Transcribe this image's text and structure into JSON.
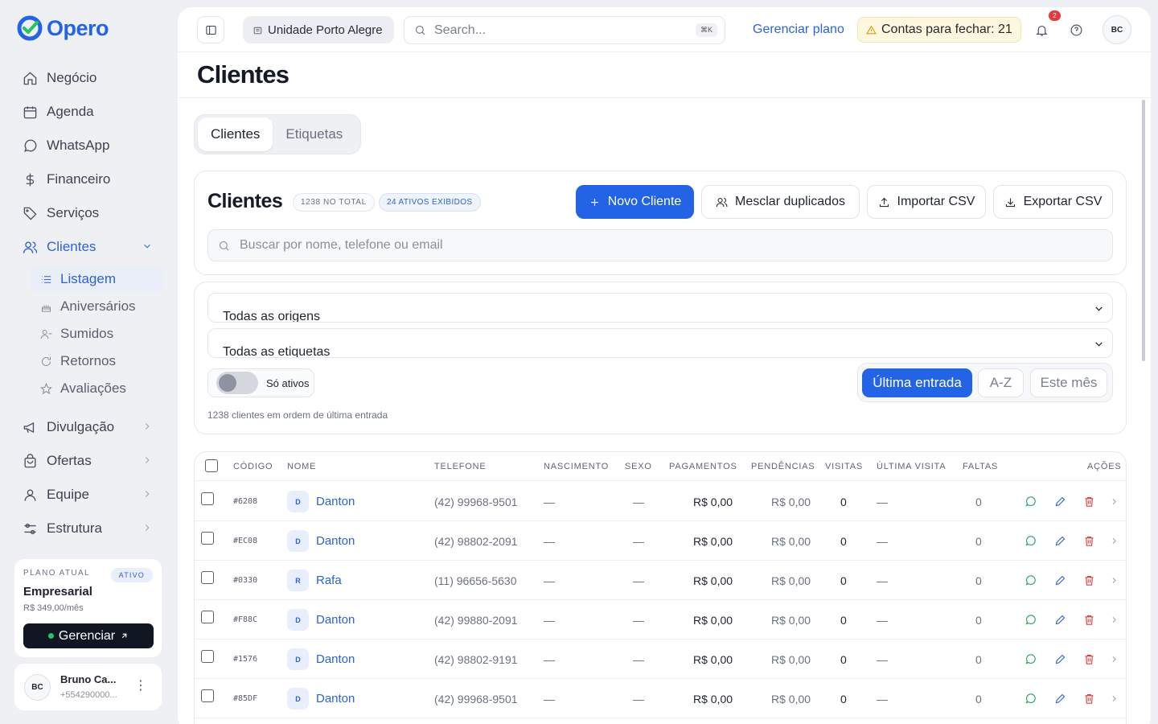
{
  "brand": {
    "name": "Opero",
    "color": "#2364e6"
  },
  "sidebar": {
    "items": [
      {
        "label": "Negócio",
        "icon": "home-icon"
      },
      {
        "label": "Agenda",
        "icon": "calendar-icon"
      },
      {
        "label": "WhatsApp",
        "icon": "message-icon"
      },
      {
        "label": "Financeiro",
        "icon": "dollar-icon"
      },
      {
        "label": "Serviços",
        "icon": "tag-icon"
      },
      {
        "label": "Clientes",
        "icon": "users-icon"
      }
    ],
    "clientes_sub": [
      {
        "label": "Listagem",
        "icon": "list-icon"
      },
      {
        "label": "Aniversários",
        "icon": "cake-icon"
      },
      {
        "label": "Sumidos",
        "icon": "user-minus-icon"
      },
      {
        "label": "Retornos",
        "icon": "refresh-icon"
      },
      {
        "label": "Avaliações",
        "icon": "star-icon"
      }
    ],
    "more_items": [
      {
        "label": "Divulgação",
        "icon": "megaphone-icon"
      },
      {
        "label": "Ofertas",
        "icon": "bag-icon"
      },
      {
        "label": "Equipe",
        "icon": "user-icon"
      },
      {
        "label": "Estrutura",
        "icon": "sliders-icon"
      }
    ],
    "plan": {
      "label": "PLANO ATUAL",
      "badge": "ATIVO",
      "name": "Empresarial",
      "price": "R$ 349,00/mês",
      "button": "Gerenciar"
    },
    "user": {
      "initials": "BC",
      "name": "Bruno Ca...",
      "phone": "+554290000..."
    }
  },
  "topbar": {
    "unit": "Unidade Porto Alegre",
    "search_placeholder": "Search...",
    "shortcut": "⌘K",
    "manage_plan": "Gerenciar plano",
    "accounts_warning": "Contas para fechar: 21",
    "notifications_count": "2",
    "avatar": "BC"
  },
  "page": {
    "title": "Clientes"
  },
  "tabs": [
    "Clientes",
    "Etiquetas"
  ],
  "clients_card": {
    "title": "Clientes",
    "badge_total": "1238 NO TOTAL",
    "badge_active": "24 ATIVOS EXIBIDOS",
    "new_client": "Novo Cliente",
    "merge": "Mesclar duplicados",
    "import": "Importar CSV",
    "export": "Exportar CSV",
    "search_placeholder": "Buscar por nome, telefone ou email"
  },
  "filters": {
    "origins": "Todas as origens",
    "tags": "Todas as etiquetas",
    "only_active": "Só ativos",
    "sort": [
      "Última entrada",
      "A-Z",
      "Este mês"
    ],
    "note": "1238 clientes em ordem de última entrada"
  },
  "table": {
    "headers": [
      "CÓDIGO",
      "NOME",
      "TELEFONE",
      "NASCIMENTO",
      "SEXO",
      "PAGAMENTOS",
      "PENDÊNCIAS",
      "VISITAS",
      "ÚLTIMA VISITA",
      "FALTAS",
      "AÇÕES"
    ],
    "rows": [
      {
        "code": "#6208",
        "initial": "D",
        "name": "Danton",
        "phone": "(42) 99968-9501",
        "birth": "—",
        "sex": "—",
        "payments": "R$ 0,00",
        "pending": "R$ 0,00",
        "visits": "0",
        "last_visit": "—",
        "absences": "0"
      },
      {
        "code": "#EC08",
        "initial": "D",
        "name": "Danton",
        "phone": "(42) 98802-2091",
        "birth": "—",
        "sex": "—",
        "payments": "R$ 0,00",
        "pending": "R$ 0,00",
        "visits": "0",
        "last_visit": "—",
        "absences": "0"
      },
      {
        "code": "#0330",
        "initial": "R",
        "name": "Rafa",
        "phone": "(11) 96656-5630",
        "birth": "—",
        "sex": "—",
        "payments": "R$ 0,00",
        "pending": "R$ 0,00",
        "visits": "0",
        "last_visit": "—",
        "absences": "0"
      },
      {
        "code": "#F88C",
        "initial": "D",
        "name": "Danton",
        "phone": "(42) 99880-2091",
        "birth": "—",
        "sex": "—",
        "payments": "R$ 0,00",
        "pending": "R$ 0,00",
        "visits": "0",
        "last_visit": "—",
        "absences": "0"
      },
      {
        "code": "#1576",
        "initial": "D",
        "name": "Danton",
        "phone": "(42) 98802-9191",
        "birth": "—",
        "sex": "—",
        "payments": "R$ 0,00",
        "pending": "R$ 0,00",
        "visits": "0",
        "last_visit": "—",
        "absences": "0"
      },
      {
        "code": "#85DF",
        "initial": "D",
        "name": "Danton",
        "phone": "(42) 99968-9501",
        "birth": "—",
        "sex": "—",
        "payments": "R$ 0,00",
        "pending": "R$ 0,00",
        "visits": "0",
        "last_visit": "—",
        "absences": "0"
      }
    ]
  },
  "colors": {
    "accent": "#2364e6",
    "whatsapp": "#22a55a",
    "edit": "#2d62d8",
    "delete": "#e03b3b",
    "warning": "#d69e05"
  }
}
